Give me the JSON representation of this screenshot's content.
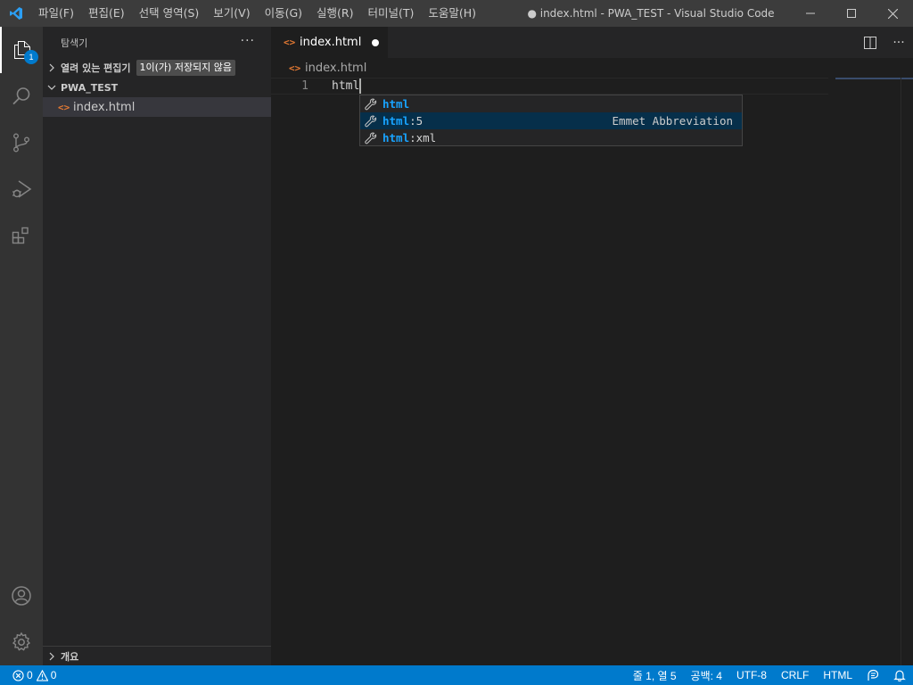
{
  "menu": [
    "파일(F)",
    "편집(E)",
    "선택 영역(S)",
    "보기(V)",
    "이동(G)",
    "실행(R)",
    "터미널(T)",
    "도움말(H)"
  ],
  "window_title": "● index.html - PWA_TEST - Visual Studio Code",
  "activity": {
    "explorer_badge": "1"
  },
  "sidebar": {
    "title": "탐색기",
    "more": "···",
    "open_editors": {
      "label": "열려 있는 편집기",
      "unsaved_badge": "1이(가) 저장되지 않음"
    },
    "folder": "PWA_TEST",
    "files": [
      {
        "name": "index.html",
        "icon": "<>"
      }
    ],
    "outline": "개요"
  },
  "editor": {
    "tab": {
      "label": "index.html",
      "icon": "<>"
    },
    "breadcrumb": "index.html",
    "line_number": "1",
    "code": "html"
  },
  "suggest": {
    "items": [
      {
        "match": "html",
        "rest": "",
        "detail": "",
        "selected": false
      },
      {
        "match": "html",
        "rest": ":5",
        "detail": "Emmet Abbreviation",
        "selected": true
      },
      {
        "match": "html",
        "rest": ":xml",
        "detail": "",
        "selected": false
      }
    ]
  },
  "statusbar": {
    "errors": "0",
    "warnings": "0",
    "position": "줄 1, 열 5",
    "spaces": "공백: 4",
    "encoding": "UTF-8",
    "eol": "CRLF",
    "language": "HTML"
  },
  "colors": {
    "accent": "#007acc",
    "html_icon": "#e37933",
    "match": "#18a3ff"
  }
}
